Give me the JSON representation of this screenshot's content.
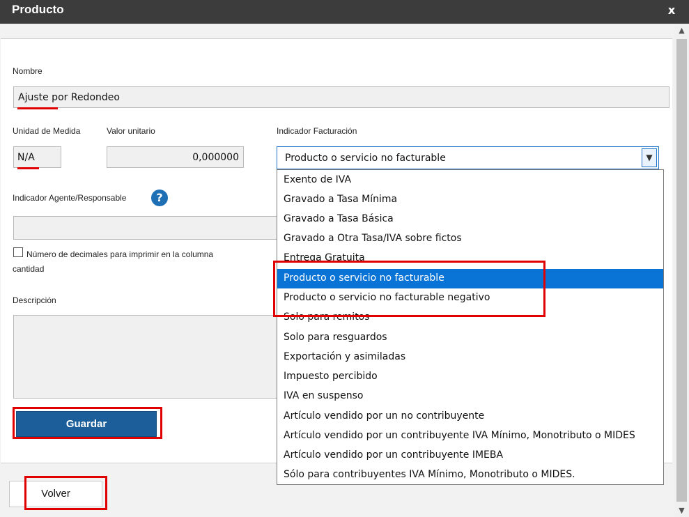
{
  "dialog": {
    "title": "Producto",
    "close_label": "x"
  },
  "form": {
    "nombre": {
      "label": "Nombre",
      "value": "Ajuste por Redondeo"
    },
    "unidad": {
      "label": "Unidad de Medida",
      "value": "N/A"
    },
    "valor": {
      "label": "Valor unitario",
      "value": "0,000000"
    },
    "indicador_facturacion": {
      "label": "Indicador Facturación",
      "selected": "Producto o servicio no facturable",
      "options": [
        "Exento de IVA",
        "Gravado a Tasa Mínima",
        "Gravado a Tasa Básica",
        "Gravado a Otra Tasa/IVA sobre fictos",
        "Entrega Gratuita",
        "Producto o servicio no facturable",
        "Producto o servicio no facturable negativo",
        "Solo para remitos",
        "Solo para resguardos",
        "Exportación y asimiladas",
        "Impuesto percibido",
        "IVA en suspenso",
        "Artículo vendido por un no contribuyente",
        "Artículo vendido por un contribuyente IVA Mínimo, Monotributo o MIDES",
        "Artículo vendido por un contribuyente IMEBA",
        "Sólo para contribuyentes IVA Mínimo, Monotributo o MIDES."
      ]
    },
    "indicador_agente": {
      "label": "Indicador Agente/Responsable",
      "help_icon": "question-icon",
      "value": ""
    },
    "decimales": {
      "label_line1": "Número de decimales para imprimir en la columna",
      "label_line2": "cantidad",
      "checked": false
    },
    "descripcion": {
      "label": "Descripción",
      "value": ""
    }
  },
  "buttons": {
    "guardar": "Guardar",
    "volver": "Volver"
  },
  "colors": {
    "titlebar": "#3c3c3c",
    "primary_button": "#1b5e9a",
    "selection": "#0a73d6",
    "highlight": "#e00000"
  }
}
